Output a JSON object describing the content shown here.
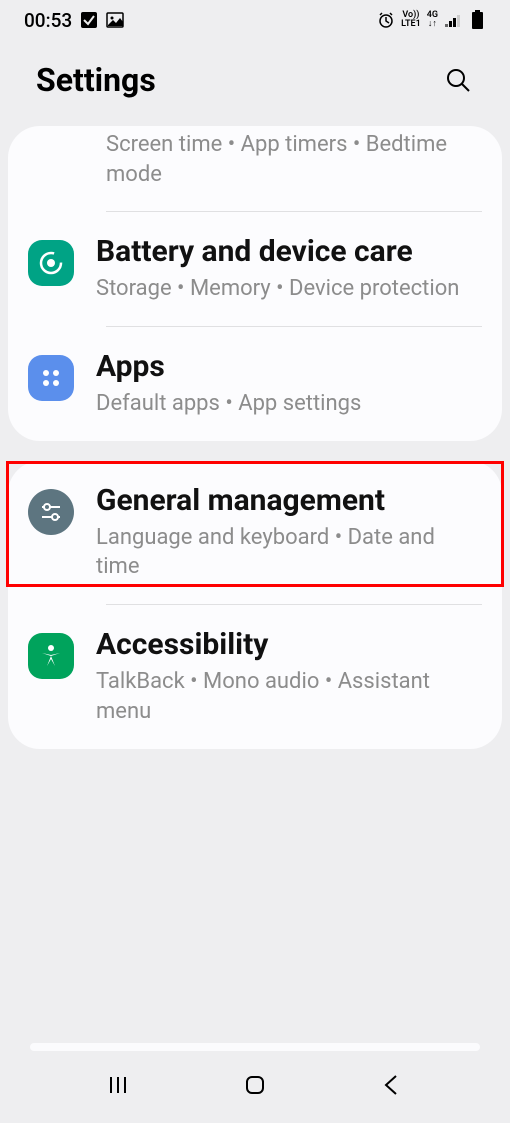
{
  "status": {
    "time": "00:53",
    "net1": "Vo))",
    "net2": "LTE1",
    "net3": "4G"
  },
  "header": {
    "title": "Settings"
  },
  "card1": {
    "partial_sub": "Screen time  •  App timers  •  Bedtime mode",
    "battery_title": "Battery and device care",
    "battery_sub": "Storage  •  Memory  •  Device protection",
    "apps_title": "Apps",
    "apps_sub": "Default apps  •  App settings"
  },
  "card2": {
    "general_title": "General management",
    "general_sub": "Language and keyboard  •  Date and time",
    "access_title": "Accessibility",
    "access_sub": "TalkBack  •  Mono audio  •  Assistant menu"
  }
}
